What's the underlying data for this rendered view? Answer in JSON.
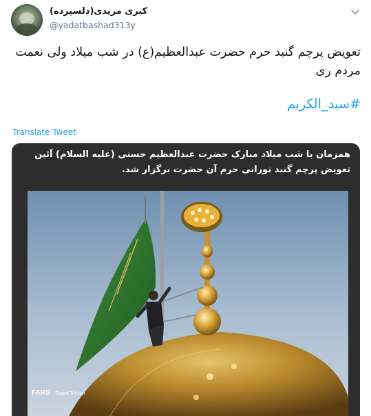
{
  "tweet": {
    "author": {
      "display_name": "کبری مریدی(دلسپرده)",
      "username": "@yadatbashad313y",
      "avatar_icon": "user-avatar"
    },
    "text": "تعویض پرچم گنبد حرم حضرت عبدالعظیم(ع) در شب میلاد ولی نعمت مردم ری",
    "hashtag": "#سید_الکریم",
    "translate_label": "Translate Tweet",
    "menu_icon": "chevron-down-icon",
    "link_color": "#1da1f2"
  },
  "media": {
    "caption": "همزمان با شب میلاد مبارک حضرت عبدالعظیم حسنی (علیه السلام) آئین تعویض پرچم گنبد نورانی حرم آن حضرت برگزار شد.",
    "watermark_agency": "FARS",
    "watermark_photographer": "Sajjad Tolouei"
  }
}
